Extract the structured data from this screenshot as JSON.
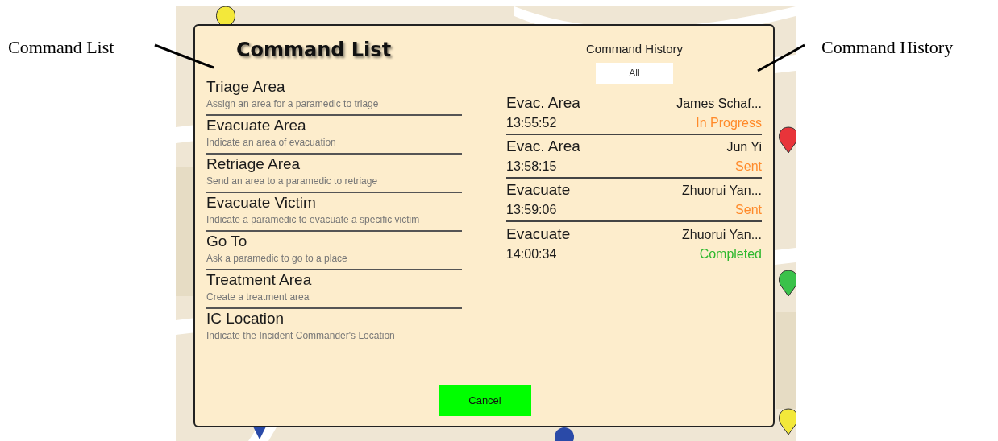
{
  "annotations": [
    {
      "label": "Command List"
    },
    {
      "label": "Command History"
    }
  ],
  "dialog": {
    "command_list": {
      "title": "Command List",
      "items": [
        {
          "name": "Triage Area",
          "description": "Assign an area for a paramedic to triage"
        },
        {
          "name": "Evacuate Area",
          "description": "Indicate an area of evacuation"
        },
        {
          "name": "Retriage Area",
          "description": "Send an area to a paramedic to retriage"
        },
        {
          "name": "Evacuate Victim",
          "description": "Indicate a paramedic to evacuate a specific victim"
        },
        {
          "name": "Go To",
          "description": "Ask a paramedic to go to a place"
        },
        {
          "name": "Treatment Area",
          "description": "Create a treatment area"
        },
        {
          "name": "IC Location",
          "description": "Indicate the Incident Commander's Location"
        }
      ]
    },
    "command_history": {
      "title": "Command History",
      "filter": "All",
      "rows": [
        {
          "command": "Evac. Area",
          "assignee": "James Schaf...",
          "time": "13:55:52",
          "status": "In Progress",
          "color": "#ff8a2a"
        },
        {
          "command": "Evac. Area",
          "assignee": "Jun Yi",
          "time": "13:58:15",
          "status": "Sent",
          "color": "#ff8a2a"
        },
        {
          "command": "Evacuate",
          "assignee": "Zhuorui Yan...",
          "time": "13:59:06",
          "status": "Sent",
          "color": "#ff8a2a"
        },
        {
          "command": "Evacuate",
          "assignee": "Zhuorui Yan...",
          "time": "14:00:34",
          "status": "Completed",
          "color": "#2eb82e"
        }
      ]
    },
    "buttons": [
      "Cancel"
    ]
  }
}
